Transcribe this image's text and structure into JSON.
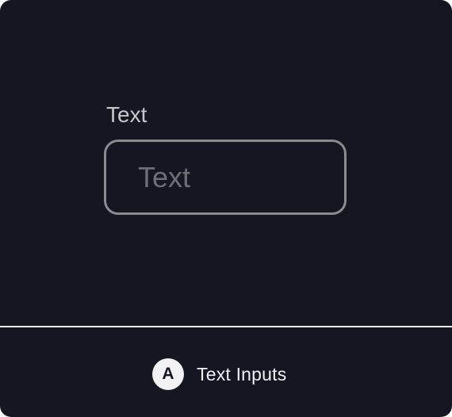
{
  "preview": {
    "field_label": "Text",
    "input_placeholder": "Text",
    "input_value": ""
  },
  "caption": {
    "badge_letter": "A",
    "title": "Text Inputs"
  },
  "colors": {
    "background": "#161622",
    "input_border": "#8a8a90",
    "label": "#c6c6cc",
    "placeholder": "#6e6e76",
    "divider": "#e9e9ee",
    "badge_bg": "#f2f2f4",
    "caption_text": "#f0f0f3"
  }
}
